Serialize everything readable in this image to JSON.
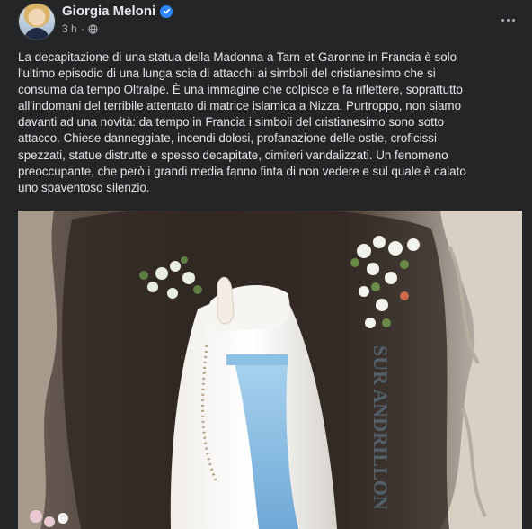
{
  "post": {
    "author": "Giorgia Meloni",
    "verified": true,
    "time": "3 h",
    "separator": "·",
    "text": "La decapitazione di una statua della Madonna a Tarn-et-Garonne in Francia è solo\nl'ultimo episodio di una lunga scia di attacchi ai simboli del cristianesimo che si\nconsuma da tempo Oltralpe. È una immagine che colpisce e fa riflettere, soprattutto\nall'indomani del terribile attentato di matrice islamica a Nizza. Purtroppo, non siamo\ndavanti ad una novità: da tempo in Francia i simboli del cristianesimo sono sotto\nattacco. Chiese danneggiate, incendi dolosi, profanazione delle ostie, croficissi\nspezzati, statue distrutte e spesso decapitate, cimiteri vandalizzati. Un fenomeno\npreoccupante, che però i grandi media fanno finta di non vedere e sul quale è calato\nuno spaventoso silenzio.",
    "photo": {
      "icon": "photo-headless-statue",
      "plaque_text": "SUR ANDRILLON"
    }
  },
  "icons": {
    "verified": "verified-badge-icon",
    "privacy": "globe-icon",
    "more": "more-options-icon"
  },
  "colors": {
    "background": "#242526",
    "text_primary": "#e4e6eb",
    "text_secondary": "#b0b3b8",
    "verified_blue": "#2d88ff"
  }
}
